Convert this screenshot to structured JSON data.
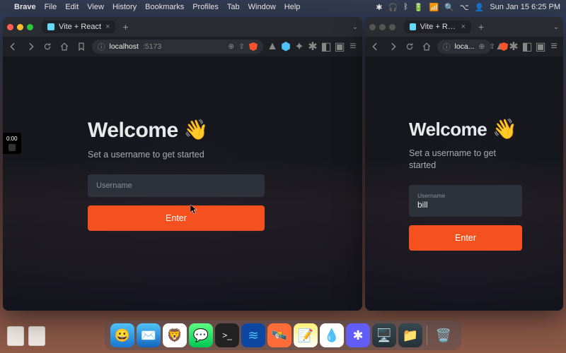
{
  "menubar": {
    "app": "Brave",
    "items": [
      "File",
      "Edit",
      "View",
      "History",
      "Bookmarks",
      "Profiles",
      "Tab",
      "Window",
      "Help"
    ],
    "clock": "Sun Jan 15  6:25 PM"
  },
  "recorder": {
    "time": "0:00"
  },
  "windows": {
    "left": {
      "tab_title": "Vite + React",
      "url_host": "localhost",
      "url_path": ":5173",
      "heading": "Welcome",
      "subheading": "Set a username to get started",
      "placeholder": "Username",
      "button": "Enter"
    },
    "right": {
      "tab_title": "Vite + React",
      "url_host": "loca...",
      "heading": "Welcome",
      "subheading": "Set a username to get started",
      "field_label": "Username",
      "field_value": "bill",
      "button": "Enter"
    }
  },
  "colors": {
    "accent": "#f4511e"
  }
}
